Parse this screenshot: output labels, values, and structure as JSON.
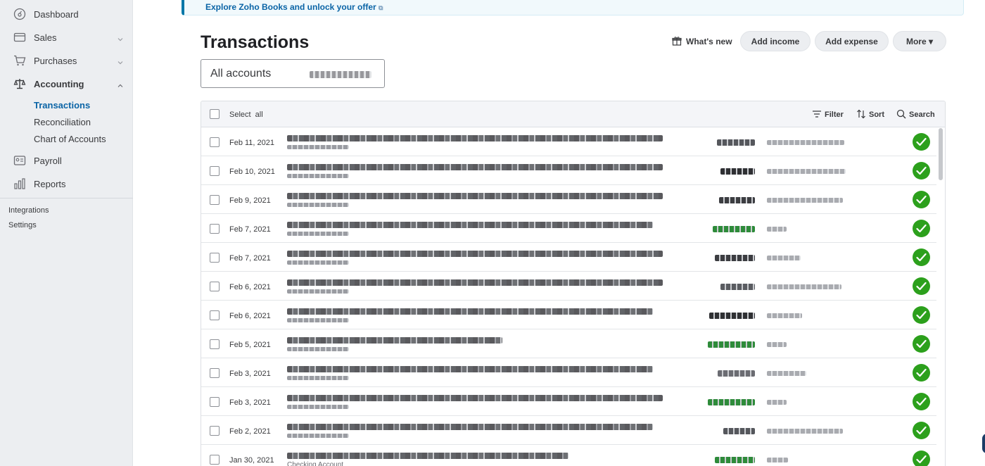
{
  "sidebar": {
    "items": [
      {
        "label": "Dashboard",
        "icon": "dashboard-icon"
      },
      {
        "label": "Sales",
        "icon": "sales-icon"
      },
      {
        "label": "Purchases",
        "icon": "cart-icon"
      },
      {
        "label": "Accounting",
        "icon": "scale-icon"
      },
      {
        "label": "Payroll",
        "icon": "payroll-icon"
      },
      {
        "label": "Reports",
        "icon": "reports-icon"
      }
    ],
    "accounting_sub": [
      "Transactions",
      "Reconciliation",
      "Chart of Accounts"
    ],
    "links": [
      "Integrations",
      "Settings"
    ]
  },
  "banner": {
    "link_text": "Explore Zoho Books and unlock your offer"
  },
  "header": {
    "title": "Transactions",
    "whats_new": "What's new",
    "add_income": "Add income",
    "add_expense": "Add expense",
    "more": "More ▾"
  },
  "account_filter": {
    "value": "All accounts"
  },
  "table": {
    "select_all": "Select  all",
    "filter": "Filter",
    "sort": "Sort",
    "search": "Search",
    "rows": [
      {
        "date": "Feb 11, 2021",
        "sub": ""
      },
      {
        "date": "Feb 10, 2021",
        "sub": ""
      },
      {
        "date": "Feb 9, 2021",
        "sub": ""
      },
      {
        "date": "Feb 7, 2021",
        "sub": ""
      },
      {
        "date": "Feb 7, 2021",
        "sub": ""
      },
      {
        "date": "Feb 6, 2021",
        "sub": ""
      },
      {
        "date": "Feb 6, 2021",
        "sub": ""
      },
      {
        "date": "Feb 5, 2021",
        "sub": ""
      },
      {
        "date": "Feb 3, 2021",
        "sub": ""
      },
      {
        "date": "Feb 3, 2021",
        "sub": ""
      },
      {
        "date": "Feb 2, 2021",
        "sub": ""
      },
      {
        "date": "Jan 30, 2021",
        "sub": "Checking Account"
      }
    ]
  },
  "colors": {
    "accent_blue": "#0a64a6",
    "status_green": "#2ca01c",
    "sidebar_bg": "#eceef1"
  }
}
